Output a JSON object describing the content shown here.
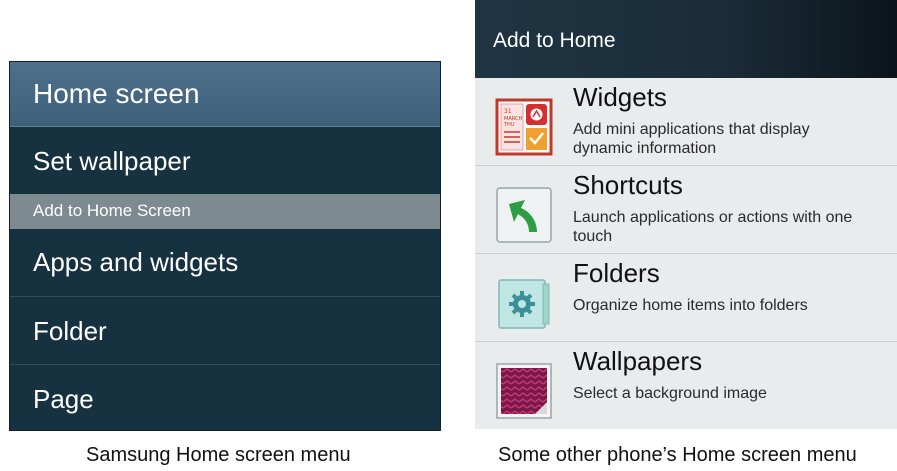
{
  "samsung_menu": {
    "title": "Home screen",
    "items": [
      {
        "label": "Set wallpaper"
      }
    ],
    "section_header": "Add to Home Screen",
    "section_items": [
      {
        "label": "Apps and widgets"
      },
      {
        "label": "Folder"
      },
      {
        "label": "Page"
      }
    ],
    "caption": "Samsung Home screen menu"
  },
  "other_menu": {
    "title": "Add to Home",
    "items": [
      {
        "title": "Widgets",
        "description": "Add mini applications that display dynamic information",
        "icon": "widgets-icon"
      },
      {
        "title": "Shortcuts",
        "description": "Launch applications or actions with one touch",
        "icon": "shortcut-arrow-icon"
      },
      {
        "title": "Folders",
        "description": "Organize home items into folders",
        "icon": "folder-gear-icon"
      },
      {
        "title": "Wallpapers",
        "description": "Select a background image",
        "icon": "wallpaper-icon"
      }
    ],
    "widget_icon_text": {
      "line1": "31",
      "line2": "MARCH",
      "line3": "THU"
    },
    "caption": "Some other phone’s Home screen menu"
  },
  "colors": {
    "samsung_bg": "#16313f",
    "samsung_header": "#4e708c",
    "samsung_section": "#7d8a90",
    "other_bg": "#e9ecec",
    "other_header": "#1a2c38"
  }
}
